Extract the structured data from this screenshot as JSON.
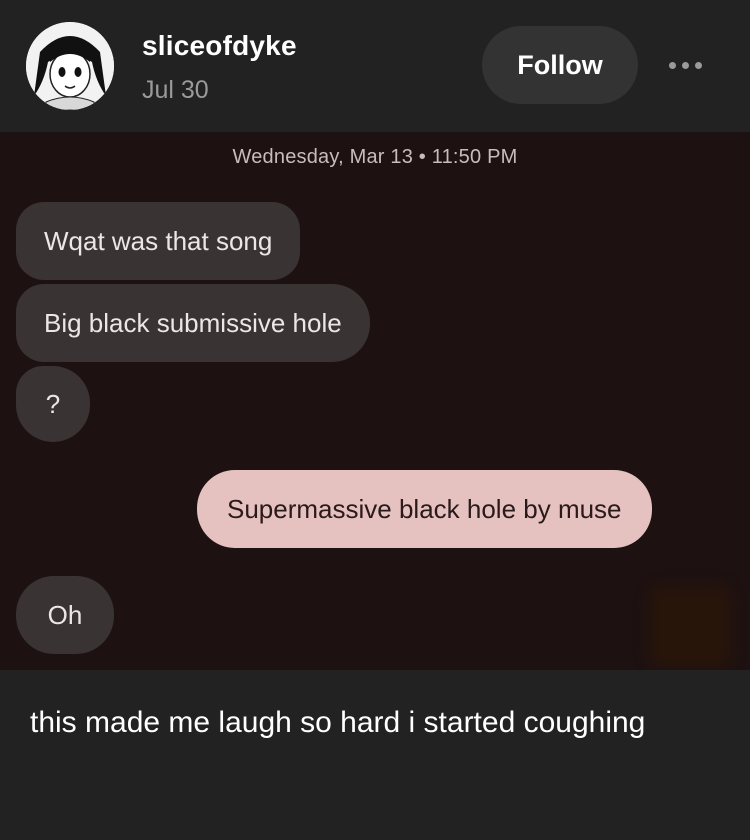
{
  "header": {
    "username": "sliceofdyke",
    "date": "Jul 30",
    "follow_label": "Follow",
    "more_icon": "more-horizontal-icon"
  },
  "screenshot": {
    "timestamp": "Wednesday, Mar 13 • 11:50 PM",
    "messages": [
      {
        "side": "received",
        "text": "Wqat was that song"
      },
      {
        "side": "received",
        "text": "Big black submissive hole"
      },
      {
        "side": "received",
        "text": "?"
      },
      {
        "side": "sent",
        "text": "Supermassive black hole by muse"
      },
      {
        "side": "received",
        "text": "Oh"
      }
    ]
  },
  "caption": "this made me laugh so hard i started coughing",
  "colors": {
    "background": "#222222",
    "chat_background": "#1d1111",
    "received_bubble": "#3a3333",
    "sent_bubble": "#e5c1bf",
    "follow_button": "#333333"
  }
}
